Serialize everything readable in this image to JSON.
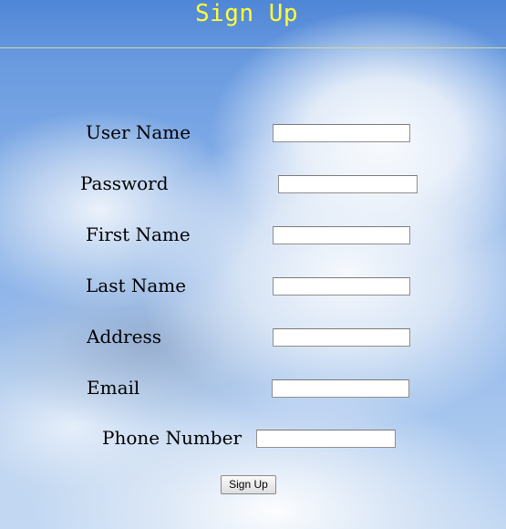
{
  "page": {
    "title": "Sign Up"
  },
  "form": {
    "fields": [
      {
        "label": "User Name",
        "value": ""
      },
      {
        "label": "Password",
        "value": ""
      },
      {
        "label": "First Name",
        "value": ""
      },
      {
        "label": "Last Name",
        "value": ""
      },
      {
        "label": "Address",
        "value": ""
      },
      {
        "label": "Email",
        "value": ""
      },
      {
        "label": "Phone Number",
        "value": ""
      }
    ],
    "submit_label": "Sign Up"
  },
  "colors": {
    "title": "#ffff33",
    "divider": "#d6d89a"
  }
}
